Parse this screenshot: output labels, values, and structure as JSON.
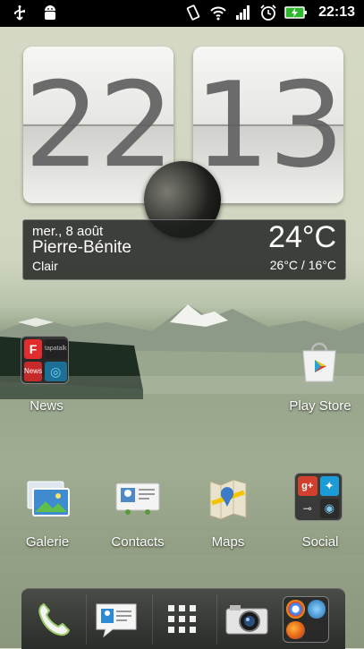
{
  "status_bar": {
    "time": "22:13",
    "left_icons": [
      "usb-icon",
      "android-debug-icon"
    ],
    "right_icons": [
      "rotate-icon",
      "wifi-icon",
      "signal-icon",
      "alarm-icon",
      "battery-charging-icon"
    ]
  },
  "clock": {
    "hours": "22",
    "minutes": "13"
  },
  "weather": {
    "date": "mer., 8 août",
    "city": "Pierre-Bénite",
    "condition": "Clair",
    "temperature": "24°C",
    "range": "26°C / 16°C"
  },
  "home_apps": [
    {
      "label": "News"
    },
    {
      "label": "Play Store"
    },
    {
      "label": "Galerie"
    },
    {
      "label": "Contacts"
    },
    {
      "label": "Maps"
    },
    {
      "label": "Social"
    }
  ],
  "news_folder": {
    "tiles": [
      "F",
      "tapatalk",
      "News",
      "◎"
    ]
  },
  "dock": [
    "phone-icon",
    "messages-icon",
    "app-drawer-icon",
    "camera-icon",
    "browser-folder-icon"
  ],
  "colors": {
    "status_bar": "#000000",
    "dock": "#2a2c29",
    "weather_panel": "#1c1e1c"
  }
}
